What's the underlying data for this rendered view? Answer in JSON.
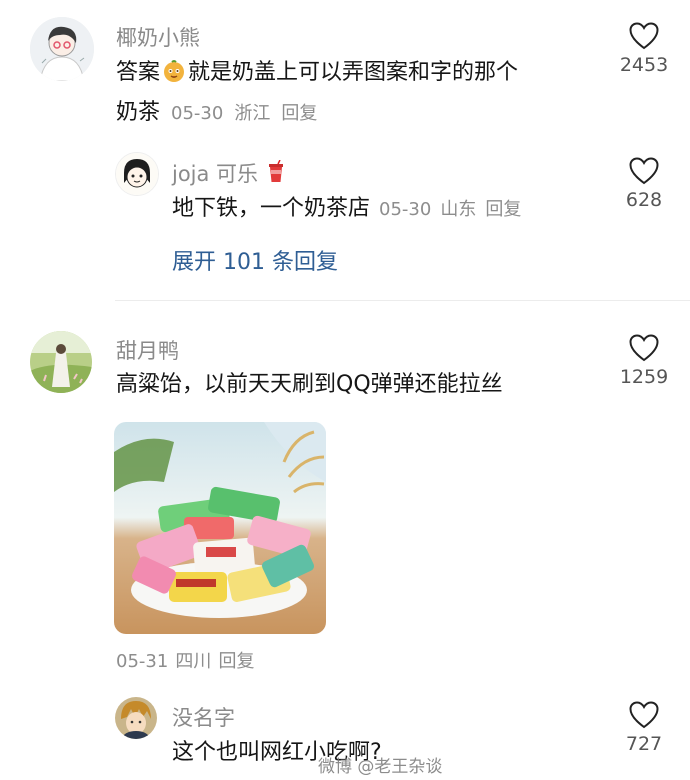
{
  "comments": [
    {
      "username": "椰奶小熊",
      "text_before_emoji": "答案",
      "emoji_icon": "face-emoji",
      "text_after_emoji": "就是奶盖上可以弄图案和字的那个",
      "text_line2": "奶茶",
      "date": "05-30",
      "location": "浙江",
      "reply_label": "回复",
      "likes": "2453",
      "replies": [
        {
          "username": "joja 可乐",
          "username_icon": "cola-cup-icon",
          "text": "地下铁，一个奶茶店",
          "date": "05-30",
          "location": "山东",
          "reply_label": "回复",
          "likes": "628"
        }
      ],
      "expand_label": "展开 101 条回复"
    },
    {
      "username": "甜月鸭",
      "text": "高粱饴，以前天天刷到QQ弹弹还能拉丝",
      "image_alt": "candy-plate-photo",
      "date": "05-31",
      "location": "四川",
      "reply_label": "回复",
      "likes": "1259",
      "replies": [
        {
          "username": "没名字",
          "text": "这个也叫网红小吃啊?",
          "likes": "727"
        }
      ]
    }
  ],
  "watermark": "微博 @老王杂谈",
  "colors": {
    "link": "#2f5e94",
    "meta": "#8d8d8d",
    "text": "#161616"
  }
}
